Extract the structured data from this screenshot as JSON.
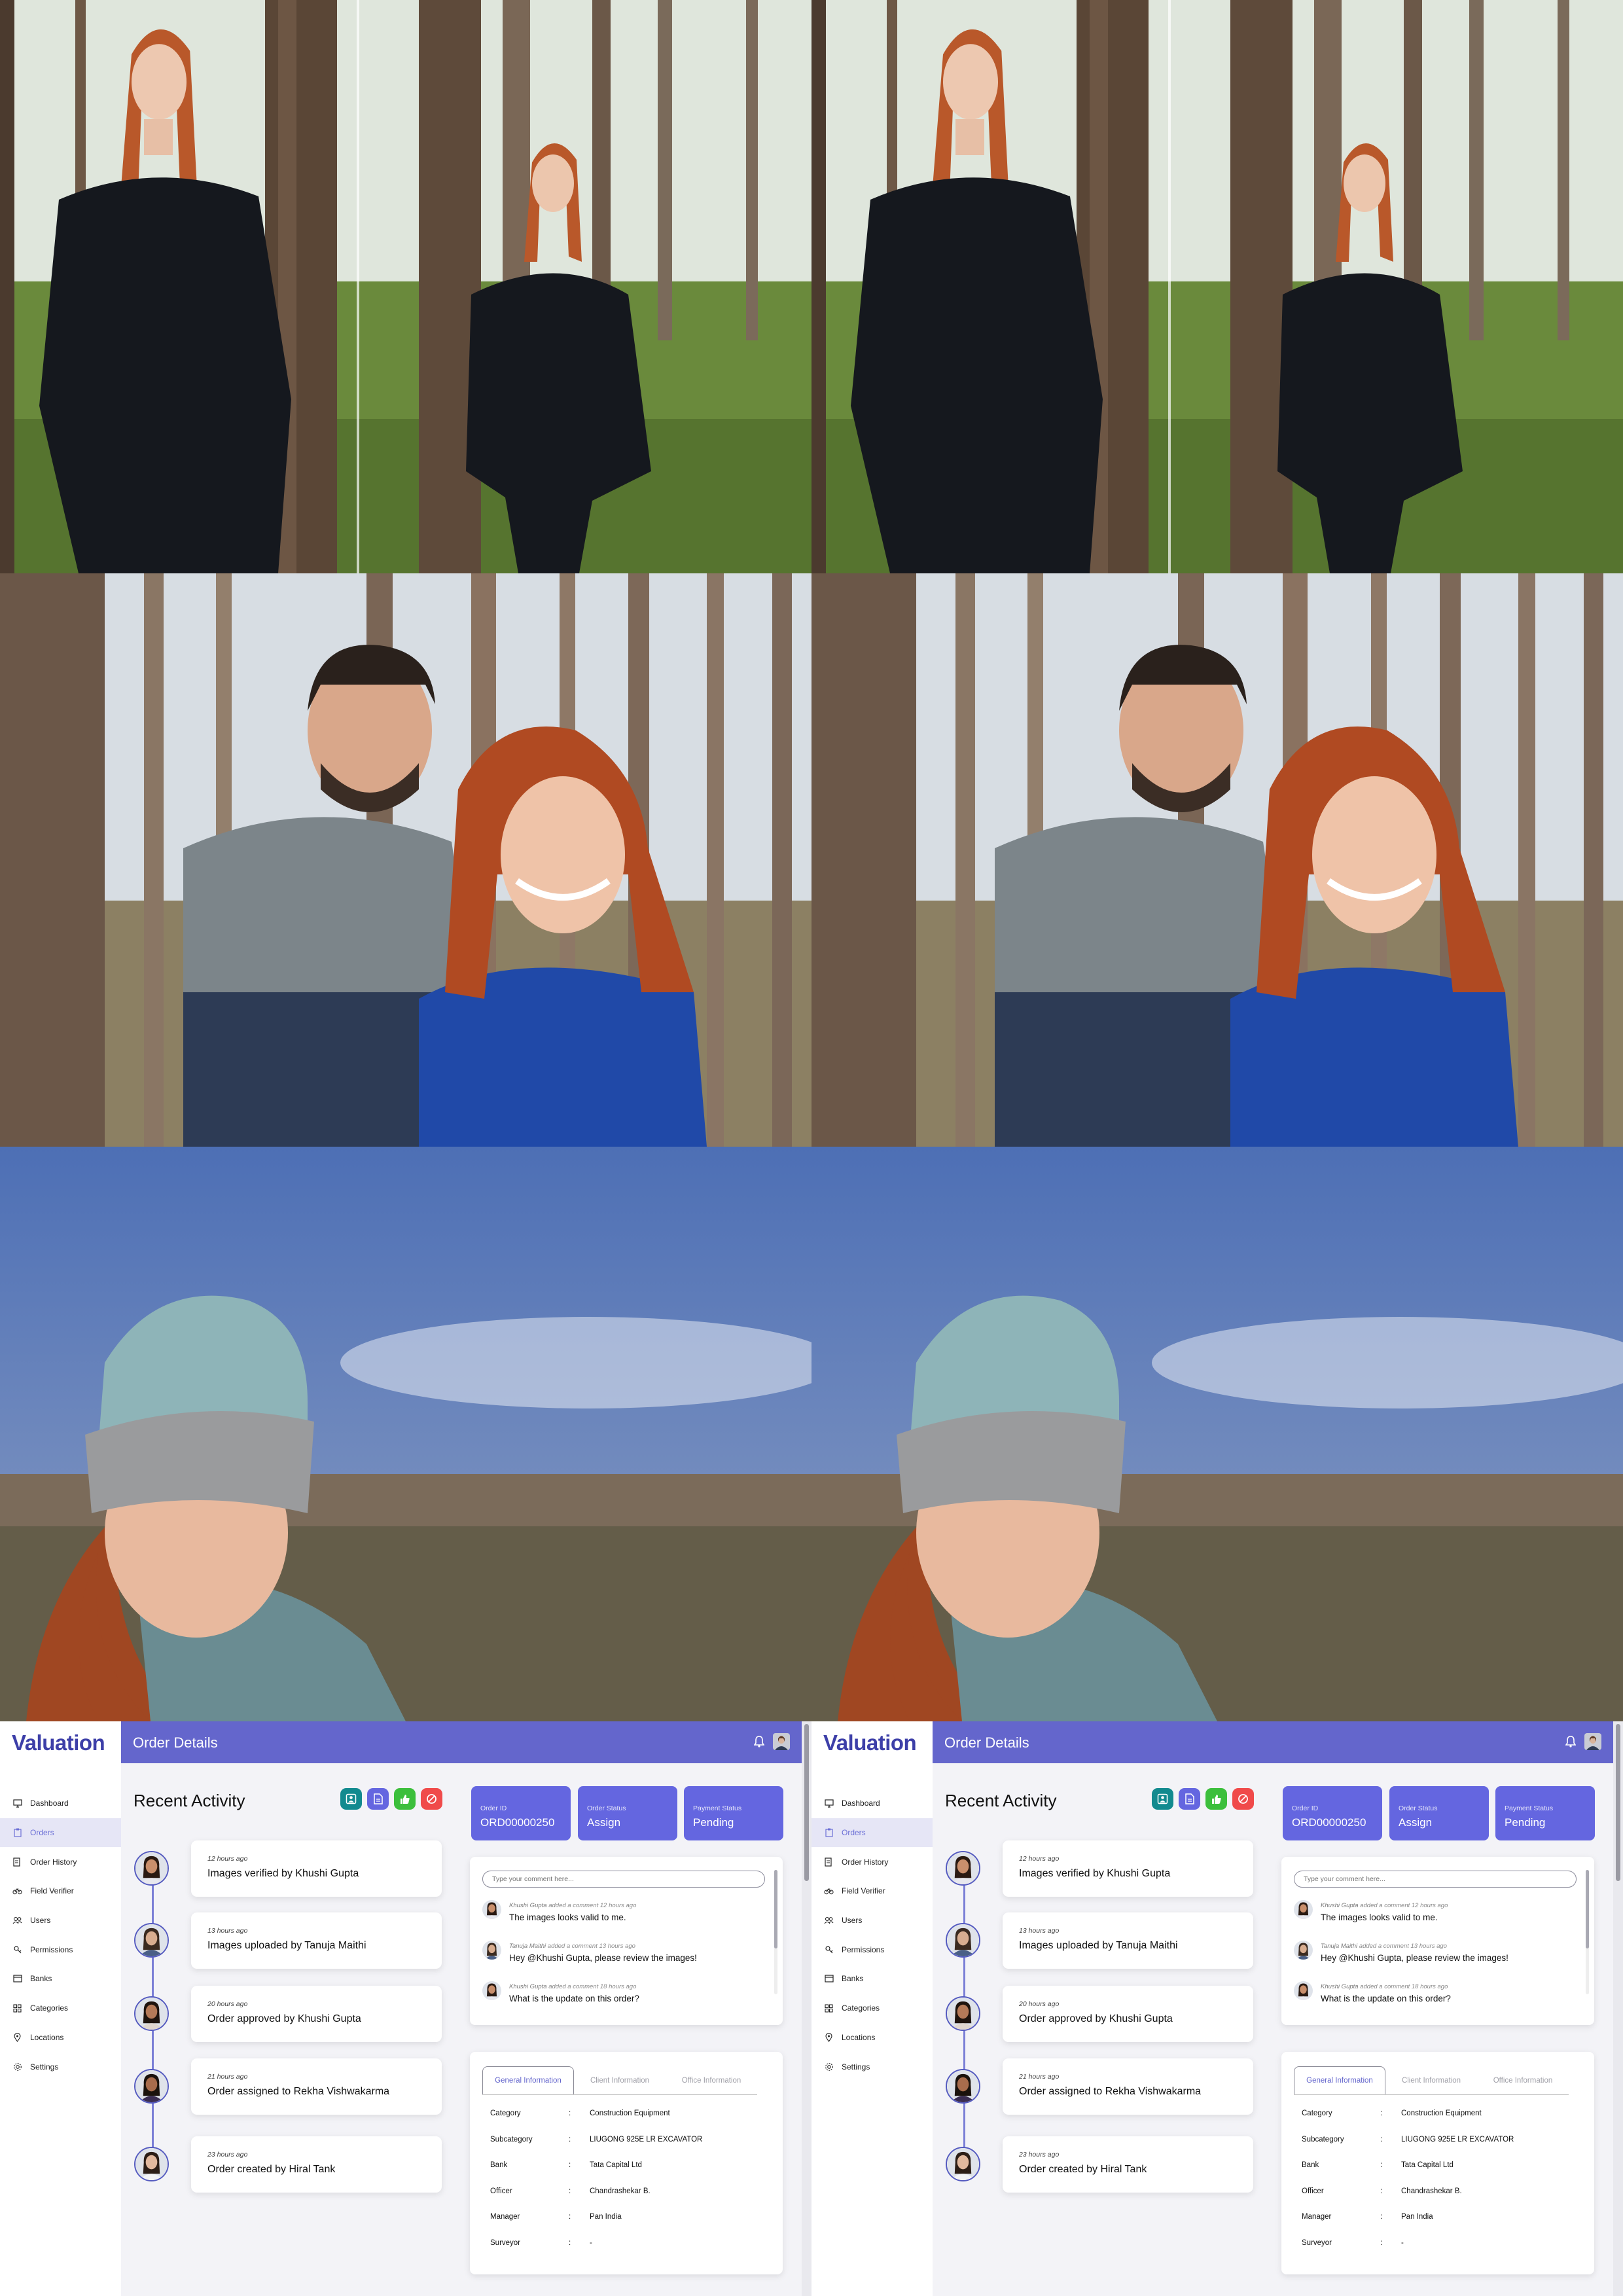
{
  "photos": [
    {
      "scene": "forest-portrait-woman-black-sweater",
      "colors": {
        "sky": "#dfe6dc",
        "grass": "#6a8a3c",
        "trunk": "#5a4636",
        "top": "#15181e",
        "hair": "#b9582a"
      }
    },
    {
      "scene": "forest-couple-smiling",
      "colors": {
        "sky": "#d7dde3",
        "grey_sweater": "#7c858a",
        "navy": "#2d3b55",
        "blue_cardigan": "#2049a8",
        "hair": "#b04a22"
      }
    },
    {
      "scene": "woman-beanie-outdoor",
      "colors": {
        "sky": "#4d6fb5",
        "beanie_top": "#8eb4b8",
        "beanie_band": "#9a9b9d",
        "hair": "#a04722",
        "jacket": "#6a8c92"
      }
    }
  ],
  "app": {
    "logo": "Valuation",
    "header_title": "Order Details",
    "brand_color": "#6466cc",
    "nav": [
      {
        "label": "Dashboard",
        "icon": "monitor-icon"
      },
      {
        "label": "Orders",
        "icon": "clipboard-icon"
      },
      {
        "label": "Order History",
        "icon": "history-icon"
      },
      {
        "label": "Field Verifier",
        "icon": "bicycle-icon"
      },
      {
        "label": "Users",
        "icon": "users-icon"
      },
      {
        "label": "Permissions",
        "icon": "key-icon"
      },
      {
        "label": "Banks",
        "icon": "card-icon"
      },
      {
        "label": "Categories",
        "icon": "grid-icon"
      },
      {
        "label": "Locations",
        "icon": "pin-icon"
      },
      {
        "label": "Settings",
        "icon": "gear-icon"
      }
    ],
    "active_nav": "Orders",
    "recent_activity": {
      "title": "Recent Activity",
      "items": [
        {
          "time": "12 hours ago",
          "message": "Images verified by Khushi Gupta"
        },
        {
          "time": "13 hours ago",
          "message": "Images uploaded by Tanuja Maithi"
        },
        {
          "time": "20 hours ago",
          "message": "Order approved by Khushi Gupta"
        },
        {
          "time": "21 hours ago",
          "message": "Order assigned to Rekha Vishwakarma"
        },
        {
          "time": "23 hours ago",
          "message": "Order created by Hiral Tank"
        }
      ]
    },
    "action_buttons": [
      {
        "icon": "assign-user-icon",
        "color": "#128a8f"
      },
      {
        "icon": "document-edit-icon",
        "color": "#6466e0"
      },
      {
        "icon": "thumbs-up-icon",
        "color": "#3cbf3c"
      },
      {
        "icon": "cancel-icon",
        "color": "#f04a4a"
      }
    ],
    "stats": [
      {
        "label": "Order ID",
        "value": "ORD00000250"
      },
      {
        "label": "Order Status",
        "value": "Assign"
      },
      {
        "label": "Payment Status",
        "value": "Pending"
      }
    ],
    "comments": {
      "placeholder": "Type your comment here...",
      "items": [
        {
          "author": "Khushi Gupta",
          "meta": " added a comment 12 hours ago",
          "text": "The images looks valid to me."
        },
        {
          "author": "Tanuja Maithi",
          "meta": " added a comment 13 hours ago",
          "text": "Hey @Khushi Gupta, please review the images!"
        },
        {
          "author": "Khushi Gupta",
          "meta": " added a comment 18 hours ago",
          "text": "What is the update on this order?"
        }
      ]
    },
    "tabs": [
      "General Information",
      "Client Information",
      "Office Information"
    ],
    "active_tab": "General Information",
    "general_info": [
      {
        "key": "Category",
        "value": "Construction Equipment"
      },
      {
        "key": "Subcategory",
        "value": "LIUGONG 925E LR EXCAVATOR"
      },
      {
        "key": "Bank",
        "value": "Tata Capital Ltd"
      },
      {
        "key": "Officer",
        "value": "Chandrashekar B."
      },
      {
        "key": "Manager",
        "value": "Pan India"
      },
      {
        "key": "Surveyor",
        "value": "-"
      }
    ],
    "separator": ":"
  }
}
